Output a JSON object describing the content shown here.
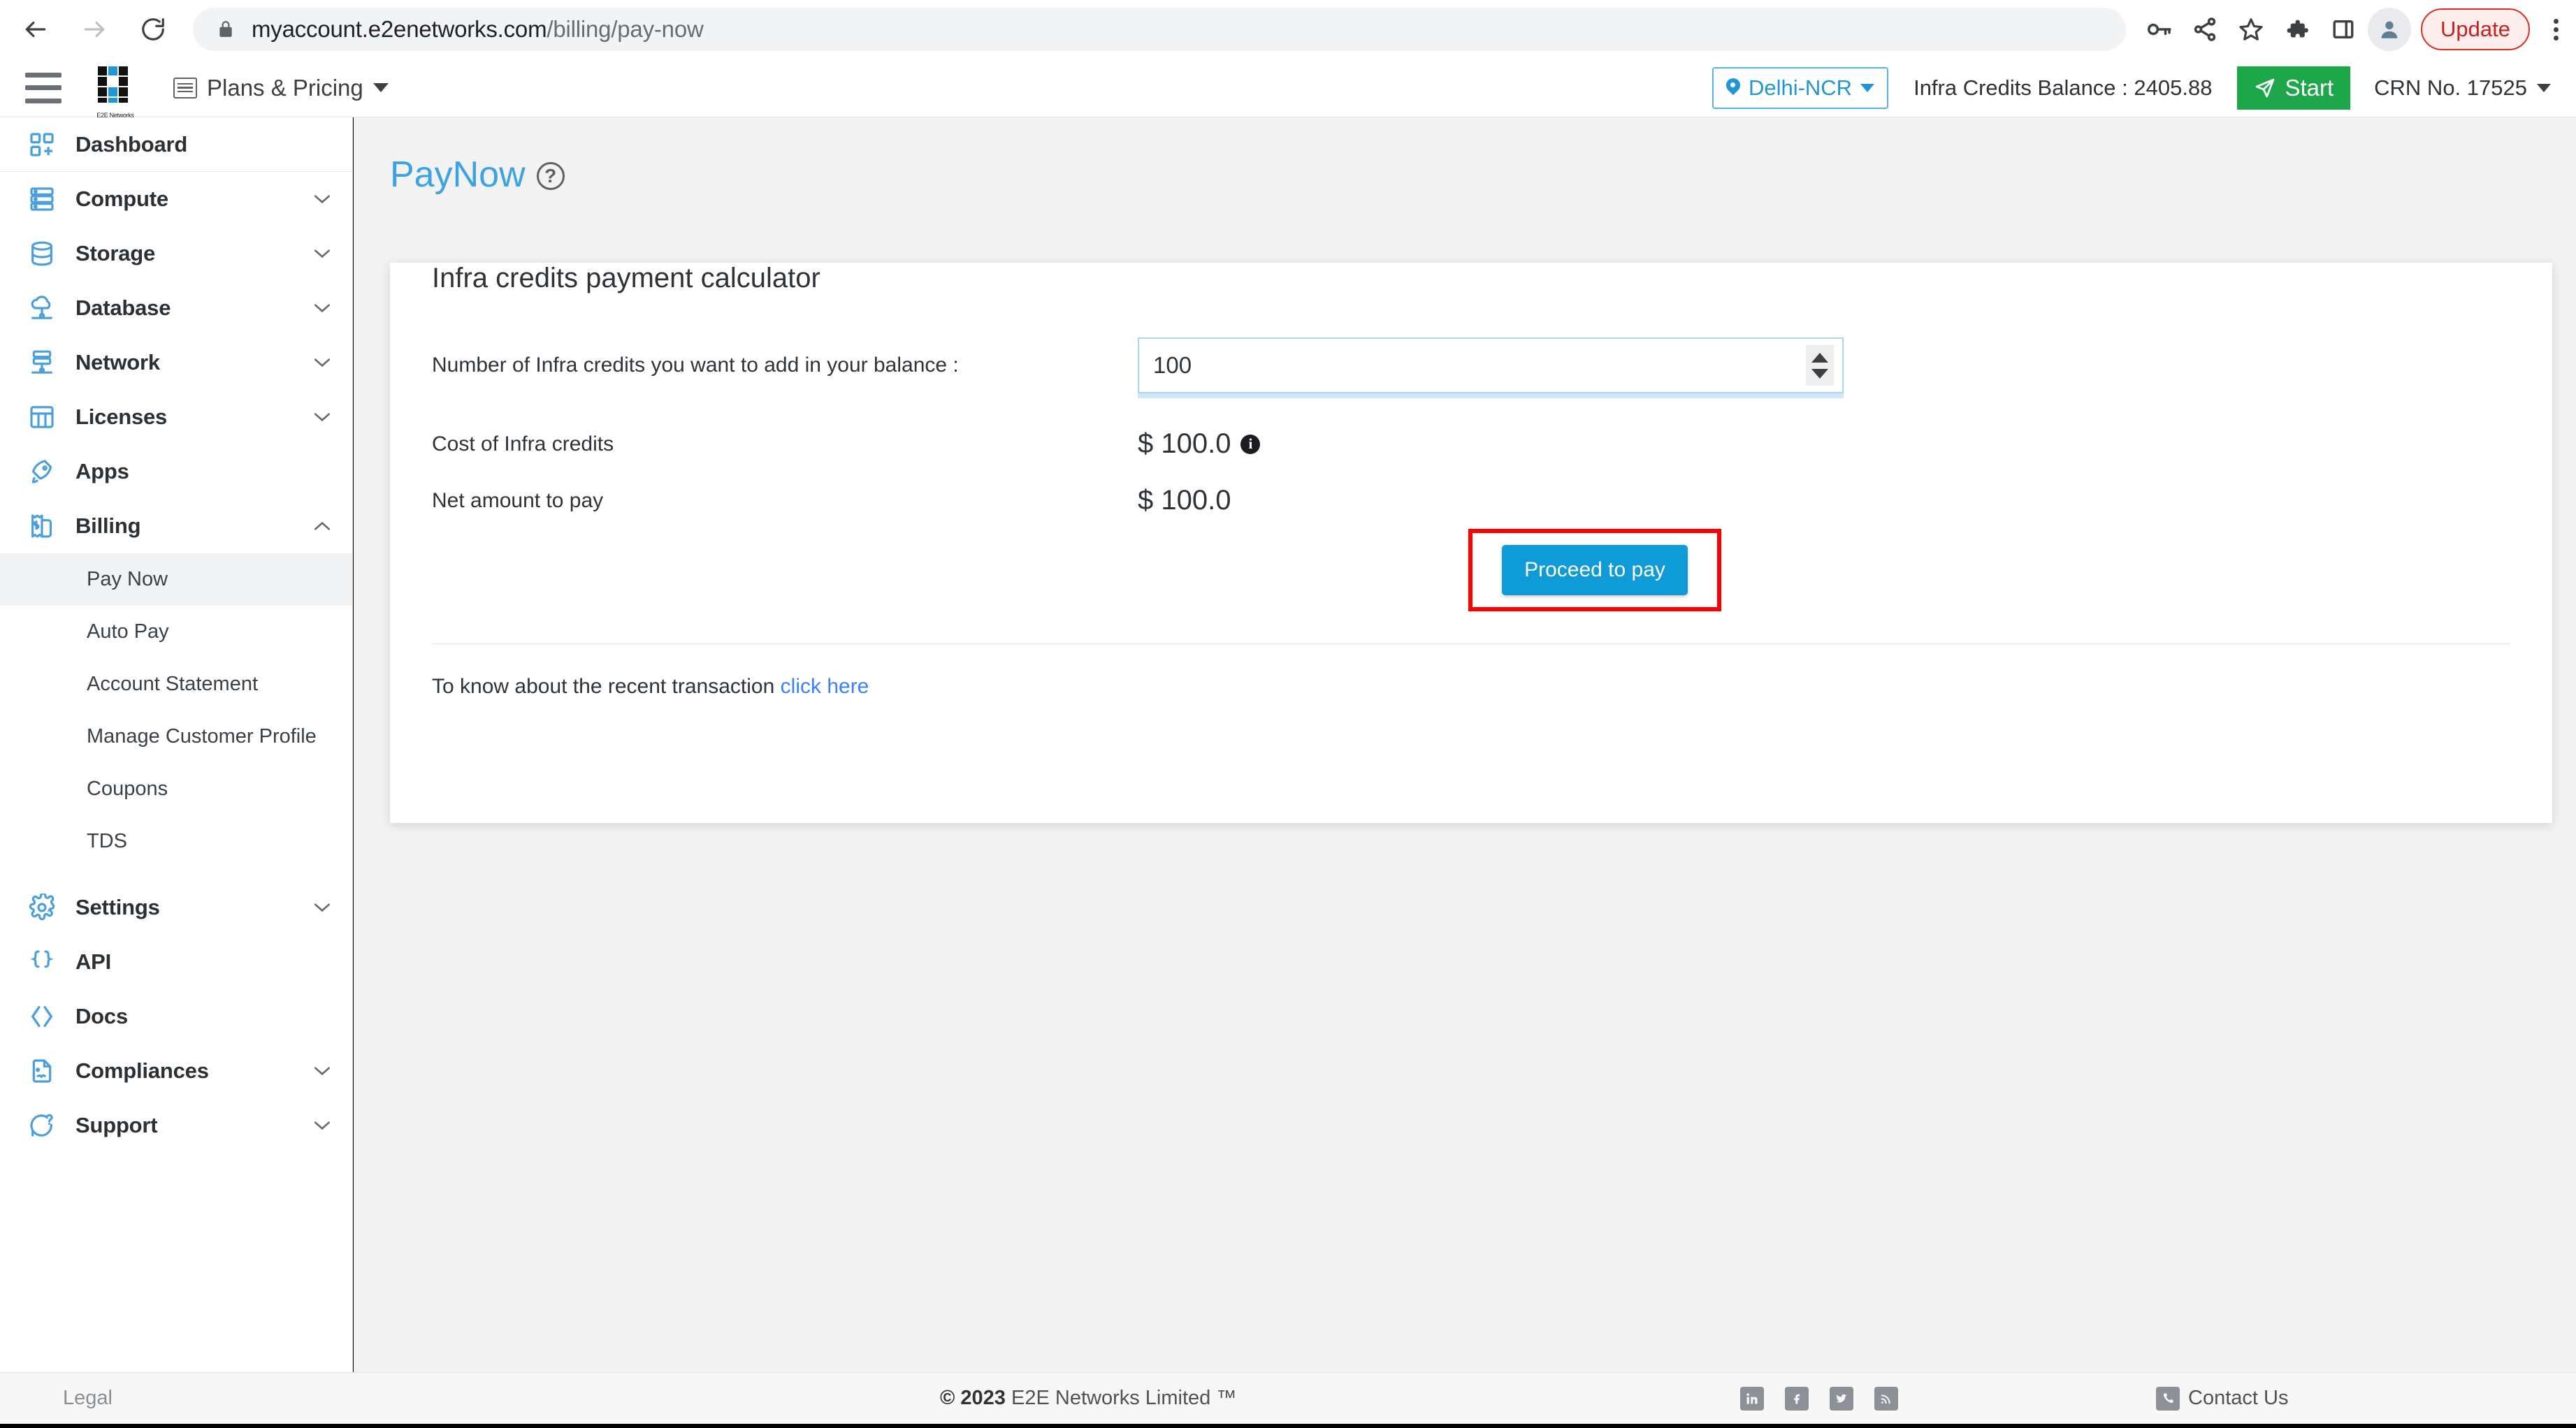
{
  "browser": {
    "back_label": "Back",
    "forward_label": "Forward",
    "reload_label": "Reload",
    "url_host": "myaccount.e2enetworks.com",
    "url_path": "/billing/pay-now",
    "update_label": "Update",
    "icons": [
      "key-icon",
      "share-icon",
      "star-icon",
      "extensions-icon",
      "sidepanel-icon",
      "profile-avatar-icon"
    ]
  },
  "header": {
    "menu_label": "Menu",
    "brand": "E2E Networks",
    "plans_pricing": "Plans & Pricing",
    "region": "Delhi-NCR",
    "credits_balance": "Infra Credits Balance : 2405.88",
    "start_label": "Start",
    "crn": "CRN No. 17525"
  },
  "sidebar": {
    "items": [
      {
        "label": "Dashboard",
        "icon": "dashboard-icon",
        "expandable": false,
        "sep": true
      },
      {
        "label": "Compute",
        "icon": "server-icon",
        "expandable": true,
        "state": "collapsed"
      },
      {
        "label": "Storage",
        "icon": "database-cylinder-icon",
        "expandable": true,
        "state": "collapsed"
      },
      {
        "label": "Database",
        "icon": "cloud-database-icon",
        "expandable": true,
        "state": "collapsed"
      },
      {
        "label": "Network",
        "icon": "network-icon",
        "expandable": true,
        "state": "collapsed"
      },
      {
        "label": "Licenses",
        "icon": "licenses-grid-icon",
        "expandable": true,
        "state": "collapsed"
      },
      {
        "label": "Apps",
        "icon": "rocket-icon",
        "expandable": false
      },
      {
        "label": "Billing",
        "icon": "billing-receipt-icon",
        "expandable": true,
        "state": "expanded"
      }
    ],
    "billing_subitems": [
      {
        "label": "Pay Now",
        "active": true
      },
      {
        "label": "Auto Pay",
        "active": false
      },
      {
        "label": "Account Statement",
        "active": false
      },
      {
        "label": "Manage Customer Profile",
        "active": false
      },
      {
        "label": "Coupons",
        "active": false
      },
      {
        "label": "TDS",
        "active": false
      }
    ],
    "items_bottom": [
      {
        "label": "Settings",
        "icon": "gear-icon",
        "expandable": true,
        "state": "collapsed"
      },
      {
        "label": "API",
        "icon": "braces-icon",
        "expandable": false
      },
      {
        "label": "Docs",
        "icon": "code-brackets-icon",
        "expandable": false
      },
      {
        "label": "Compliances",
        "icon": "document-icon",
        "expandable": true,
        "state": "collapsed"
      },
      {
        "label": "Support",
        "icon": "support-question-icon",
        "expandable": true,
        "state": "collapsed"
      }
    ]
  },
  "main": {
    "page_title": "PayNow",
    "help_glyph": "?",
    "card_title": "Infra credits payment calculator",
    "credits_label": "Number of Infra credits you want to add in your balance :",
    "credits_value": "100",
    "credits_placeholder": "",
    "cost_label": "Cost of Infra credits",
    "cost_value": "$ 100.0",
    "info_glyph": "i",
    "net_label": "Net amount to pay",
    "net_value": "$ 100.0",
    "pay_button": "Proceed to pay",
    "recent_text": "To know about the recent transaction",
    "recent_link": "click here"
  },
  "footer": {
    "legal": "Legal",
    "copyright_prefix": "© 2023",
    "copyright_text": "E2E Networks Limited ™",
    "social": [
      "linkedin-icon",
      "facebook-icon",
      "twitter-icon",
      "rss-icon"
    ],
    "social_glyphs": [
      "in",
      "f",
      "t",
      "◔"
    ],
    "contact": "Contact Us"
  },
  "colors": {
    "accent_blue": "#0f9ad8",
    "title_blue": "#3ba3e3",
    "sidebar_icon_blue": "#4a9fdc",
    "start_green": "#1da64a",
    "highlight_red": "#ff0000",
    "link_blue": "#3b82f6"
  }
}
